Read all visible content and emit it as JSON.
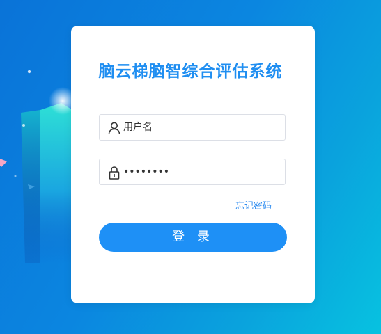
{
  "login": {
    "title": "脑云梯脑智综合评估系统",
    "username_placeholder": "用户名",
    "username_value": "",
    "password_value": "........",
    "forgot_label": "忘记密码",
    "login_label": "登 录"
  },
  "icons": {
    "username": "user-icon",
    "password": "lock-icon"
  },
  "colors": {
    "accent": "#1e90f6",
    "title": "#1f8ef1",
    "link": "#2d8cf0"
  }
}
